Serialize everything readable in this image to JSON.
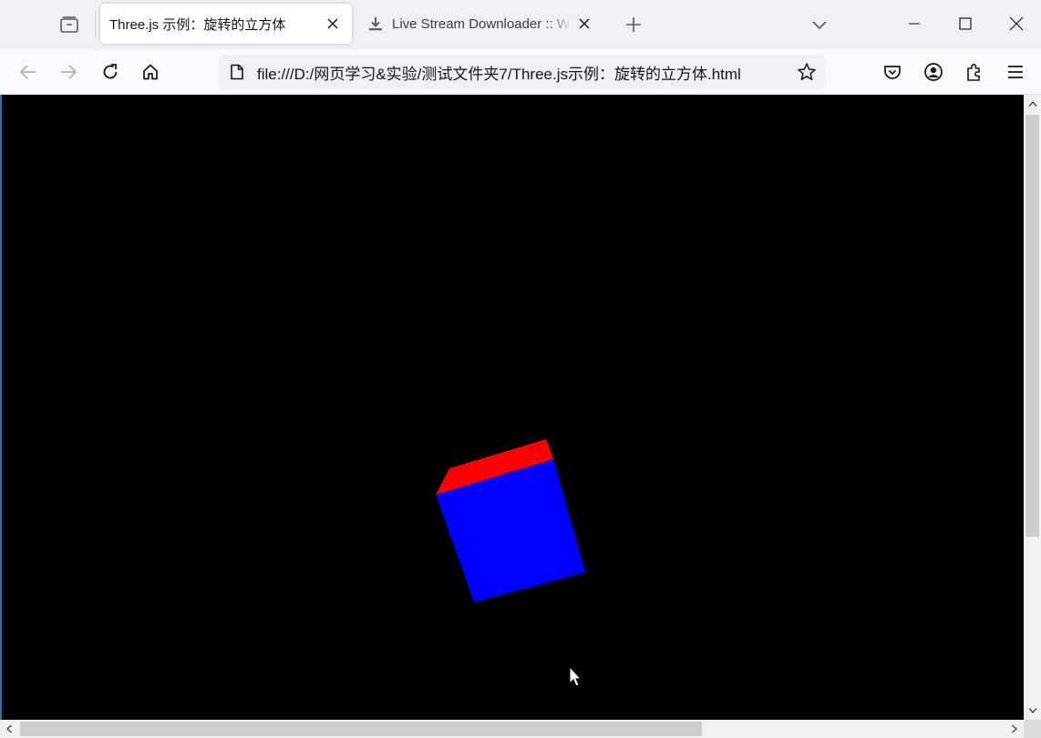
{
  "tabs": [
    {
      "title": "Three.js 示例：旋转的立方体",
      "active": true
    },
    {
      "title": "Live Stream Downloader :: We",
      "active": false
    }
  ],
  "url": "file:///D:/网页学习&实验/测试文件夹7/Three.js示例：旋转的立方体.html",
  "icons": {
    "tab_overview": "tab-overview-icon",
    "close": "close-icon",
    "download": "download-icon",
    "new_tab": "plus-icon",
    "list_tabs": "chevron-down-icon",
    "minimize": "minimize-icon",
    "maximize": "maximize-icon",
    "window_close": "close-icon",
    "back": "back-arrow-icon",
    "forward": "forward-arrow-icon",
    "reload": "reload-icon",
    "home": "home-icon",
    "page": "page-icon",
    "bookmark": "star-icon",
    "pocket": "pocket-icon",
    "account": "account-icon",
    "extensions": "puzzle-icon",
    "menu": "hamburger-menu-icon"
  },
  "scene": {
    "background": "#000000",
    "cube_top_color": "#ff0000",
    "cube_front_color": "#0000ff"
  }
}
